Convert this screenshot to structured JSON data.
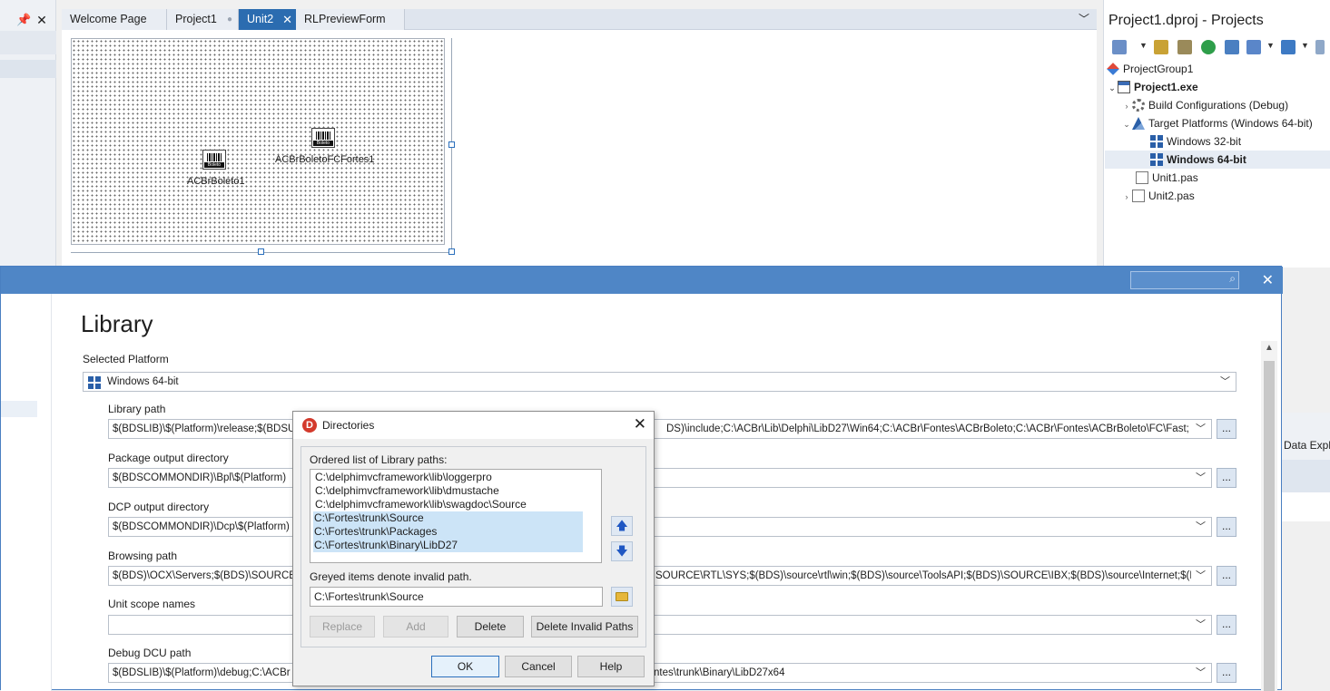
{
  "ide": {
    "tabs": [
      "Welcome Page",
      "Project1",
      "Unit2",
      "RLPreviewForm"
    ],
    "active_tab": "Unit2",
    "form_components": [
      {
        "name": "ACBrBoleto1",
        "icon_text": "Boleto"
      },
      {
        "name": "ACBrBoletoFCFortes1",
        "icon_text": "Boleto"
      }
    ]
  },
  "project_manager": {
    "title": "Project1.dproj - Projects",
    "tree": [
      {
        "label": "ProjectGroup1"
      },
      {
        "label": "Project1.exe"
      },
      {
        "label": "Build Configurations (Debug)"
      },
      {
        "label": "Target Platforms (Windows 64-bit)"
      },
      {
        "label": "Windows 32-bit"
      },
      {
        "label": "Windows 64-bit"
      },
      {
        "label": "Unit1.pas"
      },
      {
        "label": "Unit2.pas"
      }
    ],
    "side_panel_label": "Data Explo"
  },
  "options_dialog": {
    "heading": "Library",
    "selected_platform_label": "Selected Platform",
    "selected_platform_value": "Windows 64-bit",
    "fields": [
      {
        "label": "Library path",
        "left_text": "$(BDSLIB)\\$(Platform)\\release;$(BDSUS",
        "right_text": "DS)\\include;C:\\ACBr\\Lib\\Delphi\\LibD27\\Win64;C:\\ACBr\\Fontes\\ACBrBoleto;C:\\ACBr\\Fontes\\ACBrBoleto\\FC\\Fast;"
      },
      {
        "label": "Package output directory",
        "left_text": "$(BDSCOMMONDIR)\\Bpl\\$(Platform)",
        "right_text": ""
      },
      {
        "label": "DCP output directory",
        "left_text": "$(BDSCOMMONDIR)\\Dcp\\$(Platform)",
        "right_text": ""
      },
      {
        "label": "Browsing path",
        "left_text": "$(BDS)\\OCX\\Servers;$(BDS)\\SOURCE\\V",
        "right_text": "SOURCE\\RTL\\SYS;$(BDS)\\source\\rtl\\win;$(BDS)\\source\\ToolsAPI;$(BDS)\\SOURCE\\IBX;$(BDS)\\source\\Internet;$(BD"
      },
      {
        "label": "Unit scope names",
        "left_text": "",
        "right_text": ""
      },
      {
        "label": "Debug DCU path",
        "left_text": "$(BDSLIB)\\$(Platform)\\debug;C:\\ACBr",
        "right_text": "ntes\\trunk\\Binary\\LibD27x64"
      }
    ],
    "ellipsis": "..."
  },
  "directories_dialog": {
    "title": "Directories",
    "list_label": "Ordered list of Library paths:",
    "paths": [
      {
        "text": "C:\\delphimvcframework\\lib\\loggerpro",
        "selected": false
      },
      {
        "text": "C:\\delphimvcframework\\lib\\dmustache",
        "selected": false
      },
      {
        "text": "C:\\delphimvcframework\\lib\\swagdoc\\Source",
        "selected": false
      },
      {
        "text": "C:\\Fortes\\trunk\\Source",
        "selected": true
      },
      {
        "text": "C:\\Fortes\\trunk\\Packages",
        "selected": true
      },
      {
        "text": "C:\\Fortes\\trunk\\Binary\\LibD27",
        "selected": true
      }
    ],
    "greyed_note": "Greyed items denote invalid path.",
    "path_input_value": "C:\\Fortes\\trunk\\Source",
    "buttons": {
      "replace": "Replace",
      "add": "Add",
      "delete": "Delete",
      "delete_invalid": "Delete Invalid Paths",
      "ok": "OK",
      "cancel": "Cancel",
      "help": "Help"
    }
  },
  "colors": {
    "accent": "#2b6cb0",
    "titlebar": "#4f86c6",
    "selection": "#cce4f7"
  }
}
